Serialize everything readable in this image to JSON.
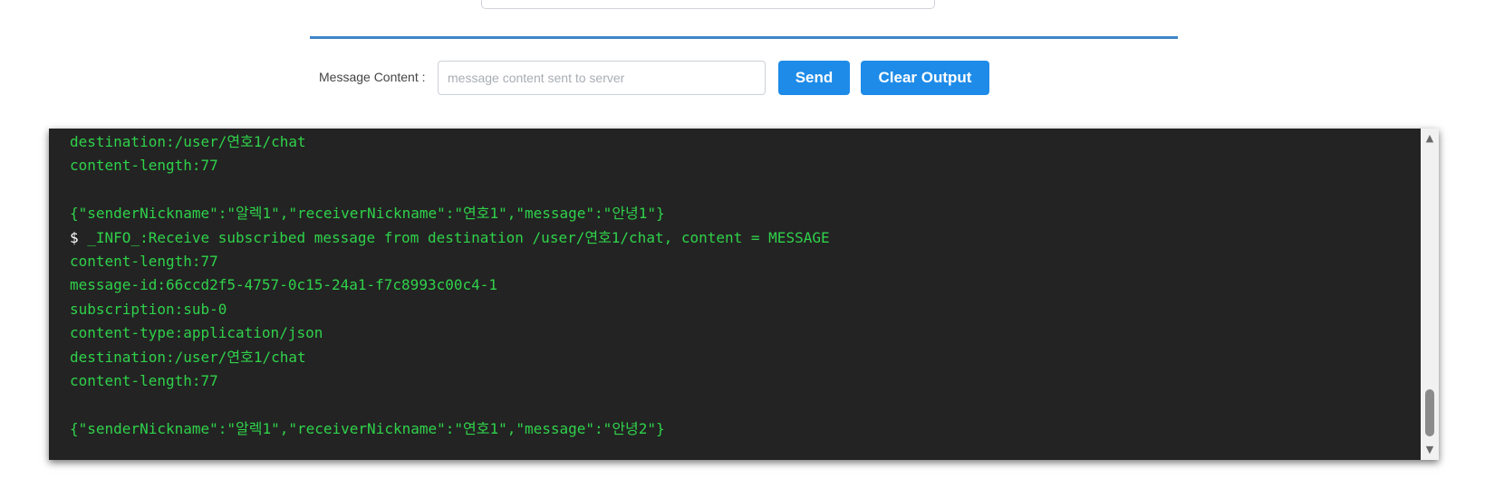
{
  "form": {
    "message_label": "Message Content :",
    "message_placeholder": "message content sent to server",
    "message_value": "",
    "send_label": "Send",
    "clear_label": "Clear Output"
  },
  "console": {
    "lines": [
      "destination:/user/연호1/chat",
      "content-length:77",
      "",
      "{\"senderNickname\":\"알렉1\",\"receiverNickname\":\"연호1\",\"message\":\"안녕1\"}",
      " _INFO_:Receive subscribed message from destination /user/연호1/chat, content = MESSAGE",
      "content-length:77",
      "message-id:66ccd2f5-4757-0c15-24a1-f7c8993c00c4-1",
      "subscription:sub-0",
      "content-type:application/json",
      "destination:/user/연호1/chat",
      "content-length:77",
      "",
      "{\"senderNickname\":\"알렉1\",\"receiverNickname\":\"연호1\",\"message\":\"안녕2\"}"
    ],
    "prompt": "$",
    "scroll_position": 0.95
  },
  "colors": {
    "accent": "#1e8be8",
    "divider": "#3f86c8",
    "console_bg": "#232323",
    "console_text": "#2fd24a"
  },
  "icons": {
    "scroll_up": "scroll-up-arrow-icon",
    "scroll_down": "scroll-down-arrow-icon"
  }
}
